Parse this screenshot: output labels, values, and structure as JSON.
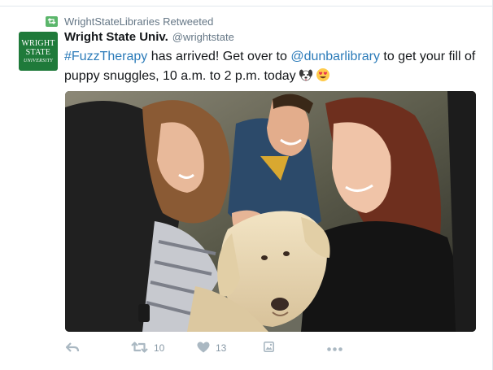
{
  "retweet_context": {
    "text": "WrightStateLibraries Retweeted"
  },
  "avatar": {
    "line1": "WRIGHT",
    "line2": "STATE",
    "line3": "UNIVERSITY"
  },
  "author": {
    "display_name": "Wright State Univ.",
    "handle": "@wrightstate"
  },
  "tweet": {
    "hashtag": "#FuzzTherapy",
    "text_part1": " has arrived! Get over to ",
    "mention": "@dunbarlibrary",
    "text_part2": " to get your fill of puppy snuggles, 10 a.m. to 2 p.m. today",
    "emojis": [
      "dog-face-emoji",
      "heart-eyes-emoji"
    ]
  },
  "actions": {
    "retweet_count": "10",
    "like_count": "13"
  },
  "icons": [
    "reply-icon",
    "retweet-icon",
    "like-icon",
    "media-icon",
    "more-icon"
  ],
  "colors": {
    "link": "#2b7bb9",
    "retweet_badge": "#5bb66b",
    "avatar_bg": "#1f7a3a",
    "action_icon": "#aab8c2"
  }
}
